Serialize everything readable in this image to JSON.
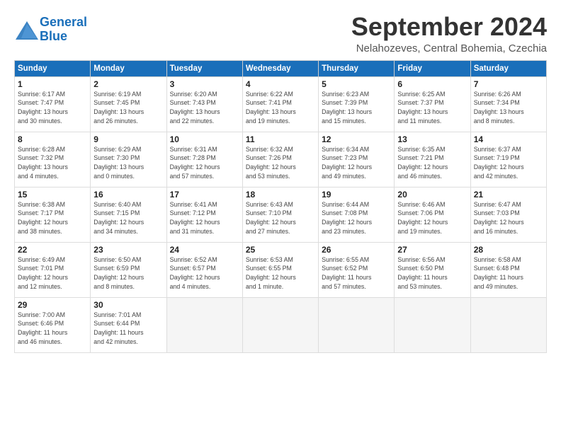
{
  "header": {
    "logo_line1": "General",
    "logo_line2": "Blue",
    "month": "September 2024",
    "location": "Nelahozeves, Central Bohemia, Czechia"
  },
  "weekdays": [
    "Sunday",
    "Monday",
    "Tuesday",
    "Wednesday",
    "Thursday",
    "Friday",
    "Saturday"
  ],
  "weeks": [
    [
      {
        "day": "1",
        "info": "Sunrise: 6:17 AM\nSunset: 7:47 PM\nDaylight: 13 hours\nand 30 minutes."
      },
      {
        "day": "2",
        "info": "Sunrise: 6:19 AM\nSunset: 7:45 PM\nDaylight: 13 hours\nand 26 minutes."
      },
      {
        "day": "3",
        "info": "Sunrise: 6:20 AM\nSunset: 7:43 PM\nDaylight: 13 hours\nand 22 minutes."
      },
      {
        "day": "4",
        "info": "Sunrise: 6:22 AM\nSunset: 7:41 PM\nDaylight: 13 hours\nand 19 minutes."
      },
      {
        "day": "5",
        "info": "Sunrise: 6:23 AM\nSunset: 7:39 PM\nDaylight: 13 hours\nand 15 minutes."
      },
      {
        "day": "6",
        "info": "Sunrise: 6:25 AM\nSunset: 7:37 PM\nDaylight: 13 hours\nand 11 minutes."
      },
      {
        "day": "7",
        "info": "Sunrise: 6:26 AM\nSunset: 7:34 PM\nDaylight: 13 hours\nand 8 minutes."
      }
    ],
    [
      {
        "day": "8",
        "info": "Sunrise: 6:28 AM\nSunset: 7:32 PM\nDaylight: 13 hours\nand 4 minutes."
      },
      {
        "day": "9",
        "info": "Sunrise: 6:29 AM\nSunset: 7:30 PM\nDaylight: 13 hours\nand 0 minutes."
      },
      {
        "day": "10",
        "info": "Sunrise: 6:31 AM\nSunset: 7:28 PM\nDaylight: 12 hours\nand 57 minutes."
      },
      {
        "day": "11",
        "info": "Sunrise: 6:32 AM\nSunset: 7:26 PM\nDaylight: 12 hours\nand 53 minutes."
      },
      {
        "day": "12",
        "info": "Sunrise: 6:34 AM\nSunset: 7:23 PM\nDaylight: 12 hours\nand 49 minutes."
      },
      {
        "day": "13",
        "info": "Sunrise: 6:35 AM\nSunset: 7:21 PM\nDaylight: 12 hours\nand 46 minutes."
      },
      {
        "day": "14",
        "info": "Sunrise: 6:37 AM\nSunset: 7:19 PM\nDaylight: 12 hours\nand 42 minutes."
      }
    ],
    [
      {
        "day": "15",
        "info": "Sunrise: 6:38 AM\nSunset: 7:17 PM\nDaylight: 12 hours\nand 38 minutes."
      },
      {
        "day": "16",
        "info": "Sunrise: 6:40 AM\nSunset: 7:15 PM\nDaylight: 12 hours\nand 34 minutes."
      },
      {
        "day": "17",
        "info": "Sunrise: 6:41 AM\nSunset: 7:12 PM\nDaylight: 12 hours\nand 31 minutes."
      },
      {
        "day": "18",
        "info": "Sunrise: 6:43 AM\nSunset: 7:10 PM\nDaylight: 12 hours\nand 27 minutes."
      },
      {
        "day": "19",
        "info": "Sunrise: 6:44 AM\nSunset: 7:08 PM\nDaylight: 12 hours\nand 23 minutes."
      },
      {
        "day": "20",
        "info": "Sunrise: 6:46 AM\nSunset: 7:06 PM\nDaylight: 12 hours\nand 19 minutes."
      },
      {
        "day": "21",
        "info": "Sunrise: 6:47 AM\nSunset: 7:03 PM\nDaylight: 12 hours\nand 16 minutes."
      }
    ],
    [
      {
        "day": "22",
        "info": "Sunrise: 6:49 AM\nSunset: 7:01 PM\nDaylight: 12 hours\nand 12 minutes."
      },
      {
        "day": "23",
        "info": "Sunrise: 6:50 AM\nSunset: 6:59 PM\nDaylight: 12 hours\nand 8 minutes."
      },
      {
        "day": "24",
        "info": "Sunrise: 6:52 AM\nSunset: 6:57 PM\nDaylight: 12 hours\nand 4 minutes."
      },
      {
        "day": "25",
        "info": "Sunrise: 6:53 AM\nSunset: 6:55 PM\nDaylight: 12 hours\nand 1 minute."
      },
      {
        "day": "26",
        "info": "Sunrise: 6:55 AM\nSunset: 6:52 PM\nDaylight: 11 hours\nand 57 minutes."
      },
      {
        "day": "27",
        "info": "Sunrise: 6:56 AM\nSunset: 6:50 PM\nDaylight: 11 hours\nand 53 minutes."
      },
      {
        "day": "28",
        "info": "Sunrise: 6:58 AM\nSunset: 6:48 PM\nDaylight: 11 hours\nand 49 minutes."
      }
    ],
    [
      {
        "day": "29",
        "info": "Sunrise: 7:00 AM\nSunset: 6:46 PM\nDaylight: 11 hours\nand 46 minutes."
      },
      {
        "day": "30",
        "info": "Sunrise: 7:01 AM\nSunset: 6:44 PM\nDaylight: 11 hours\nand 42 minutes."
      },
      {
        "day": "",
        "info": ""
      },
      {
        "day": "",
        "info": ""
      },
      {
        "day": "",
        "info": ""
      },
      {
        "day": "",
        "info": ""
      },
      {
        "day": "",
        "info": ""
      }
    ]
  ]
}
